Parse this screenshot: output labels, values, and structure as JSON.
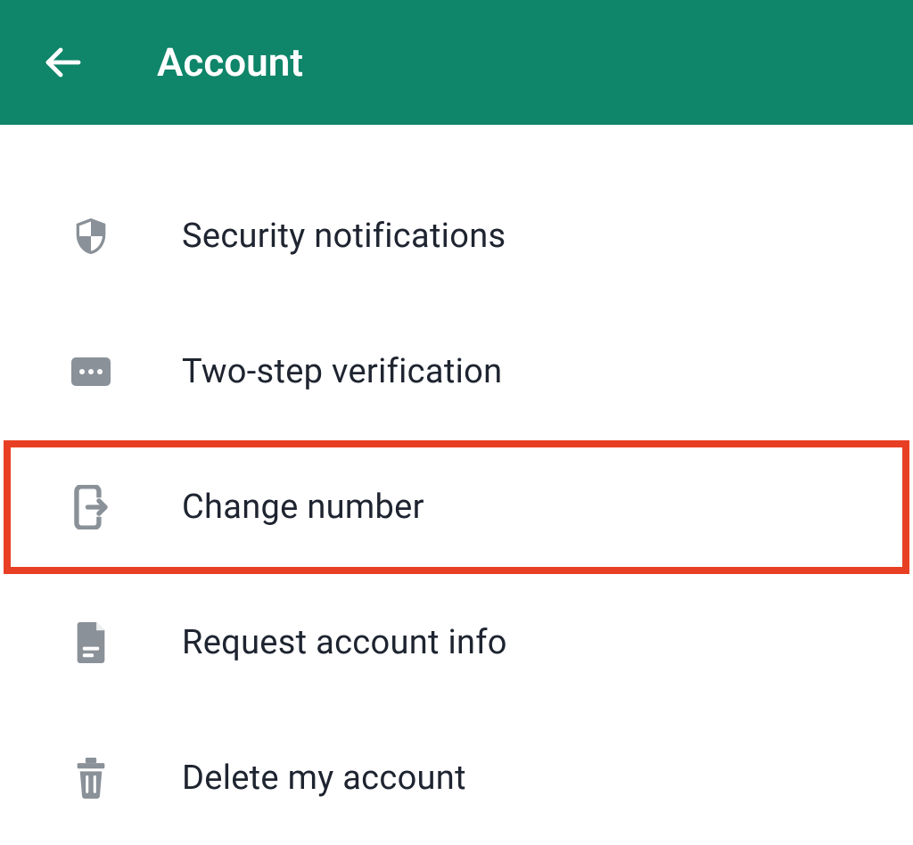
{
  "header": {
    "title": "Account"
  },
  "items": [
    {
      "id": "security-notifications",
      "label": "Security notifications",
      "icon": "shield-icon",
      "highlight": false
    },
    {
      "id": "two-step-verification",
      "label": "Two-step verification",
      "icon": "dots-box-icon",
      "highlight": false
    },
    {
      "id": "change-number",
      "label": "Change number",
      "icon": "phone-exit-icon",
      "highlight": true
    },
    {
      "id": "request-account-info",
      "label": "Request account info",
      "icon": "document-icon",
      "highlight": false
    },
    {
      "id": "delete-my-account",
      "label": "Delete my account",
      "icon": "trash-icon",
      "highlight": false
    }
  ],
  "colors": {
    "accent": "#0f8569",
    "highlight": "#e83f24",
    "icon": "#8a9198",
    "text": "#1e2430"
  }
}
